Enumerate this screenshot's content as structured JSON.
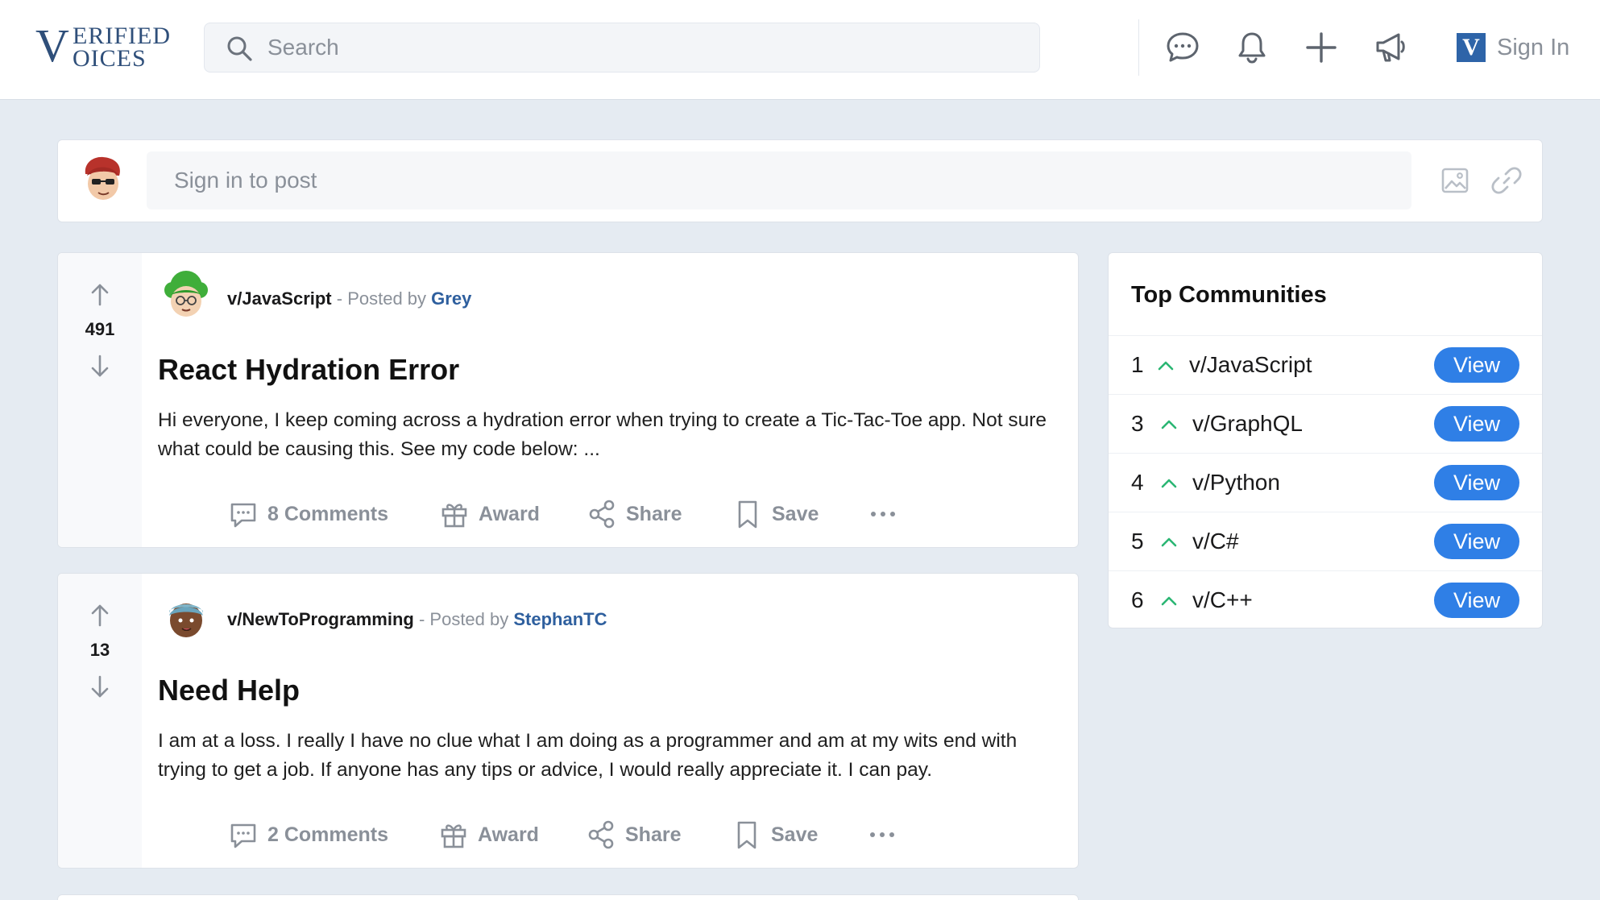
{
  "header": {
    "logo": {
      "big_letter": "V",
      "line1": "ERIFIED",
      "line2": "OICES"
    },
    "search": {
      "placeholder": "Search",
      "value": ""
    },
    "sign_in": {
      "badge": "V",
      "label": "Sign In"
    }
  },
  "create_post": {
    "placeholder": "Sign in to post"
  },
  "posts": [
    {
      "votes": "491",
      "community": "v/JavaScript",
      "separator": " - Posted by ",
      "author": "Grey",
      "title": "React Hydration Error",
      "body": "Hi everyone, I keep coming across a hydration error when trying to create a Tic-Tac-Toe app. Not sure what could be causing this. See my code below: ...",
      "comments_label": "8 Comments",
      "award_label": "Award",
      "share_label": "Share",
      "save_label": "Save"
    },
    {
      "votes": "13",
      "community": "v/NewToProgramming",
      "separator": " - Posted by ",
      "author": "StephanTC",
      "title": "Need Help",
      "body": "I am at a loss. I really I have no clue what I am doing as a programmer and am at my wits end with trying to get a job. If anyone has any tips or advice, I would really appreciate it. I can pay.",
      "comments_label": "2 Comments",
      "award_label": "Award",
      "share_label": "Share",
      "save_label": "Save"
    }
  ],
  "sidebar": {
    "title": "Top Communities",
    "communities": [
      {
        "rank": "1",
        "name": "v/JavaScript",
        "button": "View"
      },
      {
        "rank": "3",
        "name": "v/GraphQL",
        "button": "View"
      },
      {
        "rank": "4",
        "name": "v/Python",
        "button": "View"
      },
      {
        "rank": "5",
        "name": "v/C#",
        "button": "View"
      },
      {
        "rank": "6",
        "name": "v/C++",
        "button": "View"
      }
    ]
  },
  "colors": {
    "accent": "#2f7fe6",
    "brand": "#2f4f7a",
    "author_link": "#2e5f9e",
    "trend_up": "#2bb673",
    "muted": "#8a9099",
    "background": "#e5ebf2"
  },
  "icons": {
    "header": [
      "chat-icon",
      "bell-icon",
      "plus-icon",
      "megaphone-icon"
    ],
    "post_actions": [
      "comment-icon",
      "gift-icon",
      "share-icon",
      "bookmark-icon",
      "more-icon"
    ]
  }
}
